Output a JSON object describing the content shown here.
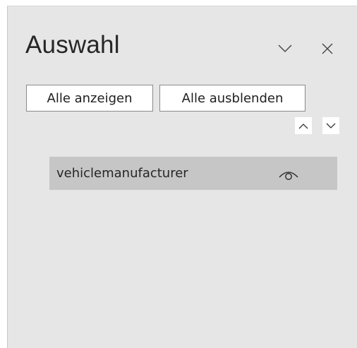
{
  "pane": {
    "title": "Auswahl",
    "collapse_icon": "chevron-down-icon",
    "close_icon": "close-icon"
  },
  "toolbar": {
    "show_all_label": "Alle anzeigen",
    "hide_all_label": "Alle ausblenden",
    "move_up_icon": "chevron-up-icon",
    "move_down_icon": "chevron-down-icon"
  },
  "items": [
    {
      "label": "vehiclemanufacturer",
      "visibility_icon": "eye-icon"
    }
  ],
  "colors": {
    "pane_bg": "#e6e6e6",
    "selected_row_bg": "#c6c6c6",
    "text": "#262626"
  }
}
